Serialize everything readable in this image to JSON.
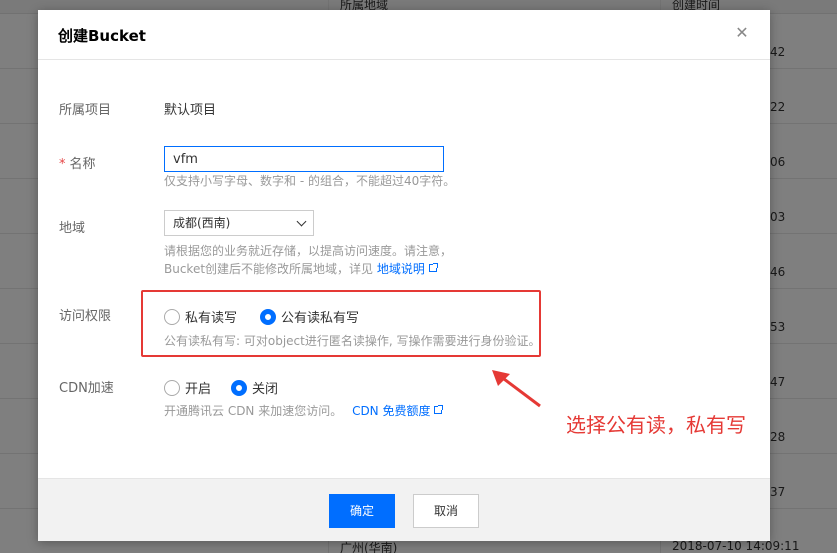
{
  "background": {
    "header": {
      "col1": "所属地域",
      "col2": "创建时间"
    },
    "row_tails": [
      "42",
      "22",
      "06",
      "03",
      "46",
      "53",
      "47",
      "28",
      "37"
    ],
    "last_row": {
      "region": "广州(华南)",
      "time": "2018-07-10 14:09:11"
    }
  },
  "modal": {
    "title": "创建Bucket",
    "close_icon": "close-icon",
    "project": {
      "label": "所属项目",
      "value": "默认项目"
    },
    "name": {
      "required_mark": "*",
      "label": "名称",
      "value": "vfm",
      "hint": "仅支持小写字母、数字和 - 的组合，不能超过40字符。"
    },
    "region": {
      "label": "地域",
      "selected": "成都(西南)",
      "hint_line1": "请根据您的业务就近存储，以提高访问速度。请注意，",
      "hint_line2": "Bucket创建后不能修改所属地域，详见",
      "hint_link": "地域说明"
    },
    "access": {
      "label": "访问权限",
      "options": [
        "私有读写",
        "公有读私有写"
      ],
      "selected_index": 1,
      "hint": "公有读私有写: 可对object进行匿名读操作, 写操作需要进行身份验证。"
    },
    "cdn": {
      "label": "CDN加速",
      "options": [
        "开启",
        "关闭"
      ],
      "selected_index": 1,
      "hint": "开通腾讯云 CDN 来加速您访问。",
      "hint_link": "CDN 免费额度"
    },
    "footer": {
      "confirm": "确定",
      "cancel": "取消"
    }
  },
  "annotation": {
    "text": "选择公有读，私有写",
    "color": "#e53935"
  },
  "colors": {
    "primary": "#006eff",
    "highlight": "#e53935"
  }
}
